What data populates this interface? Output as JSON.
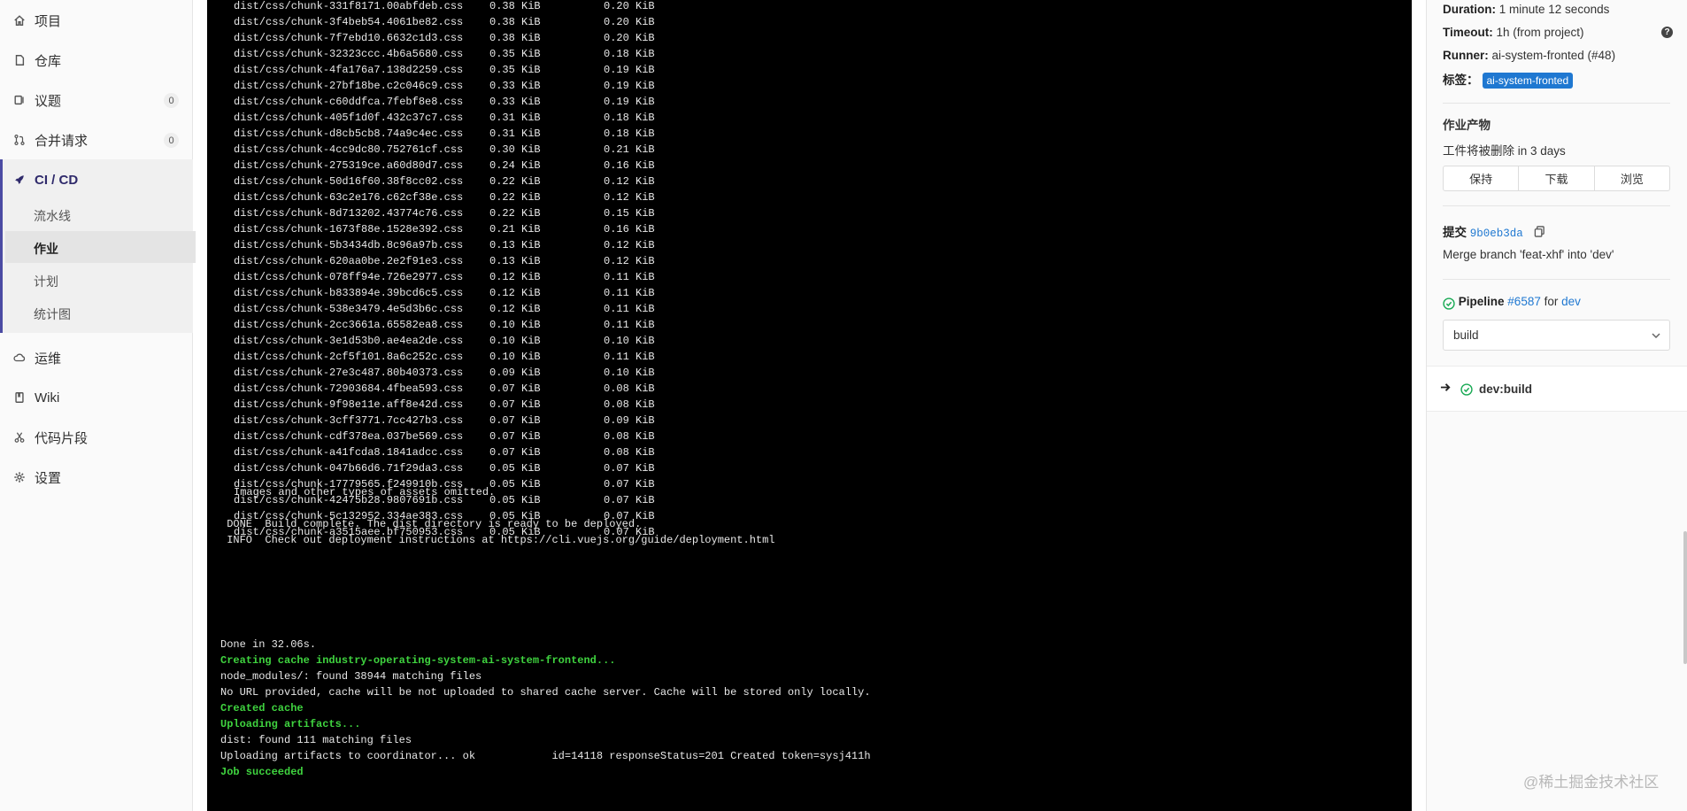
{
  "sidebar": {
    "items": [
      {
        "label": "项目"
      },
      {
        "label": "仓库"
      },
      {
        "label": "议题",
        "count": "0"
      },
      {
        "label": "合并请求",
        "count": "0"
      },
      {
        "label": "CI / CD"
      },
      {
        "label": "运维"
      },
      {
        "label": "Wiki"
      },
      {
        "label": "代码片段"
      },
      {
        "label": "设置"
      }
    ],
    "cicd_sub": [
      "流水线",
      "作业",
      "计划",
      "统计图"
    ],
    "active_sub": "作业"
  },
  "terminal": {
    "assets": [
      [
        "dist/css/chunk-331f8171.00abfdeb.css",
        "0.38 KiB",
        "0.20 KiB"
      ],
      [
        "dist/css/chunk-3f4beb54.4061be82.css",
        "0.38 KiB",
        "0.20 KiB"
      ],
      [
        "dist/css/chunk-7f7ebd10.6632c1d3.css",
        "0.38 KiB",
        "0.20 KiB"
      ],
      [
        "dist/css/chunk-32323ccc.4b6a5680.css",
        "0.35 KiB",
        "0.18 KiB"
      ],
      [
        "dist/css/chunk-4fa176a7.138d2259.css",
        "0.35 KiB",
        "0.19 KiB"
      ],
      [
        "dist/css/chunk-27bf18be.c2c046c9.css",
        "0.33 KiB",
        "0.19 KiB"
      ],
      [
        "dist/css/chunk-c60ddfca.7febf8e8.css",
        "0.33 KiB",
        "0.19 KiB"
      ],
      [
        "dist/css/chunk-405f1d0f.432c37c7.css",
        "0.31 KiB",
        "0.18 KiB"
      ],
      [
        "dist/css/chunk-d8cb5cb8.74a9c4ec.css",
        "0.31 KiB",
        "0.18 KiB"
      ],
      [
        "dist/css/chunk-4cc9dc80.752761cf.css",
        "0.30 KiB",
        "0.21 KiB"
      ],
      [
        "dist/css/chunk-275319ce.a60d80d7.css",
        "0.24 KiB",
        "0.16 KiB"
      ],
      [
        "dist/css/chunk-50d16f60.38f8cc02.css",
        "0.22 KiB",
        "0.12 KiB"
      ],
      [
        "dist/css/chunk-63c2e176.c62cf38e.css",
        "0.22 KiB",
        "0.12 KiB"
      ],
      [
        "dist/css/chunk-8d713202.43774c76.css",
        "0.22 KiB",
        "0.15 KiB"
      ],
      [
        "dist/css/chunk-1673f88e.1528e392.css",
        "0.21 KiB",
        "0.16 KiB"
      ],
      [
        "dist/css/chunk-5b3434db.8c96a97b.css",
        "0.13 KiB",
        "0.12 KiB"
      ],
      [
        "dist/css/chunk-620aa0be.2e2f91e3.css",
        "0.13 KiB",
        "0.12 KiB"
      ],
      [
        "dist/css/chunk-078ff94e.726e2977.css",
        "0.12 KiB",
        "0.11 KiB"
      ],
      [
        "dist/css/chunk-b833894e.39bcd6c5.css",
        "0.12 KiB",
        "0.11 KiB"
      ],
      [
        "dist/css/chunk-538e3479.4e5d3b6c.css",
        "0.12 KiB",
        "0.11 KiB"
      ],
      [
        "dist/css/chunk-2cc3661a.65582ea8.css",
        "0.10 KiB",
        "0.11 KiB"
      ],
      [
        "dist/css/chunk-3e1d53b0.ae4ea2de.css",
        "0.10 KiB",
        "0.10 KiB"
      ],
      [
        "dist/css/chunk-2cf5f101.8a6c252c.css",
        "0.10 KiB",
        "0.11 KiB"
      ],
      [
        "dist/css/chunk-27e3c487.80b40373.css",
        "0.09 KiB",
        "0.10 KiB"
      ],
      [
        "dist/css/chunk-72903684.4fbea593.css",
        "0.07 KiB",
        "0.08 KiB"
      ],
      [
        "dist/css/chunk-9f98e11e.aff8e42d.css",
        "0.07 KiB",
        "0.08 KiB"
      ],
      [
        "dist/css/chunk-3cff3771.7cc427b3.css",
        "0.07 KiB",
        "0.09 KiB"
      ],
      [
        "dist/css/chunk-cdf378ea.037be569.css",
        "0.07 KiB",
        "0.08 KiB"
      ],
      [
        "dist/css/chunk-a41fcda8.1841adcc.css",
        "0.07 KiB",
        "0.08 KiB"
      ],
      [
        "dist/css/chunk-047b66d6.71f29da3.css",
        "0.05 KiB",
        "0.07 KiB"
      ],
      [
        "dist/css/chunk-17779565.f249910b.css",
        "0.05 KiB",
        "0.07 KiB"
      ],
      [
        "dist/css/chunk-42475b28.9807691b.css",
        "0.05 KiB",
        "0.07 KiB"
      ],
      [
        "dist/css/chunk-5c132952.334ae383.css",
        "0.05 KiB",
        "0.07 KiB"
      ],
      [
        "dist/css/chunk-a3515aee.bf750953.css",
        "0.05 KiB",
        "0.07 KiB"
      ]
    ],
    "omitted": "Images and other types of assets omitted.",
    "done": " DONE  Build complete. The dist directory is ready to be deployed.",
    "info": " INFO  Check out deployment instructions at https://cli.vuejs.org/guide/deployment.html",
    "tail": [
      {
        "text": "Done in 32.06s.",
        "green": false
      },
      {
        "text": "Creating cache industry-operating-system-ai-system-frontend...",
        "green": true
      },
      {
        "text": "node_modules/: found 38944 matching files",
        "green": false
      },
      {
        "text": "No URL provided, cache will be not uploaded to shared cache server. Cache will be stored only locally.",
        "green": false
      },
      {
        "text": "Created cache",
        "green": true
      },
      {
        "text": "Uploading artifacts...",
        "green": true
      },
      {
        "text": "dist: found 111 matching files",
        "green": false
      },
      {
        "text": "Uploading artifacts to coordinator... ok            id=14118 responseStatus=201 Created token=sysj411h",
        "green": false
      },
      {
        "text": "Job succeeded",
        "green": true
      }
    ]
  },
  "info": {
    "duration_label": "Duration:",
    "duration_value": "1 minute 12 seconds",
    "timeout_label": "Timeout:",
    "timeout_value": "1h (from project)",
    "runner_label": "Runner:",
    "runner_value": "ai-system-fronted (#48)",
    "tags_label": "标签：",
    "tag": "ai-system-fronted",
    "help": "?"
  },
  "artifacts": {
    "title": "作业产物",
    "expire_prefix": "工件将被删除",
    "expire_value": "in 3 days",
    "buttons": [
      "保持",
      "下载",
      "浏览"
    ]
  },
  "commit": {
    "label": "提交",
    "sha": "9b0eb3da",
    "message": "Merge branch 'feat-xhf' into 'dev'"
  },
  "pipeline": {
    "label": "Pipeline",
    "number": "#6587",
    "for": "for",
    "branch": "dev",
    "stage": "build",
    "job": "dev:build"
  },
  "watermark": "@稀土掘金技术社区",
  "colors": {
    "accent": "#1f78d1",
    "success": "#1aaa55",
    "terminal_green": "#3fd33f"
  }
}
